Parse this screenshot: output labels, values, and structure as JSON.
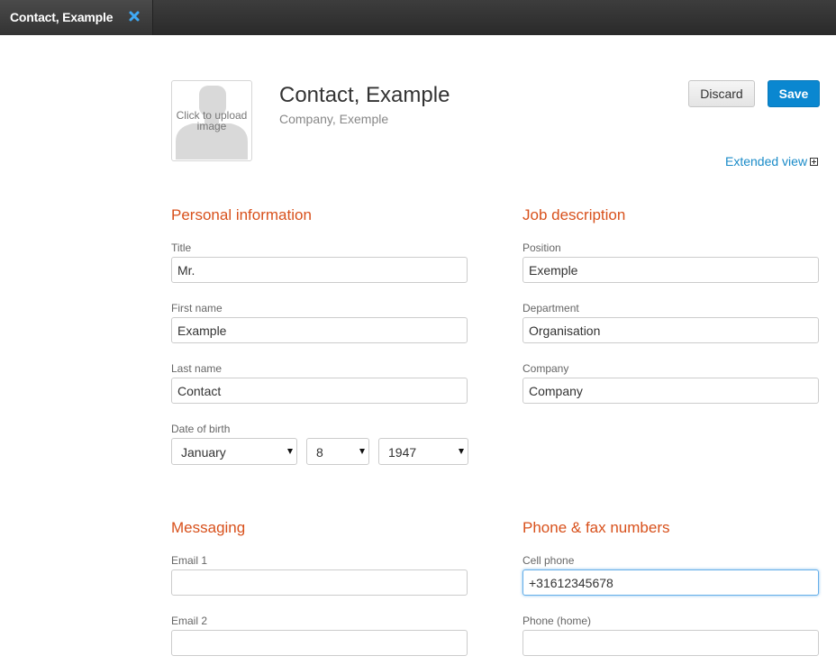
{
  "tab": {
    "label": "Contact, Example",
    "close_icon": "close-icon",
    "close_color": "#3fa9f5"
  },
  "header": {
    "photo_text": "Click to upload image",
    "name": "Contact, Example",
    "company": "Company, Exemple",
    "discard_label": "Discard",
    "save_label": "Save",
    "extended_view_label": "Extended view"
  },
  "personal": {
    "title": "Personal information",
    "title_label": "Title",
    "title_value": "Mr.",
    "first_name_label": "First name",
    "first_name_value": "Example",
    "last_name_label": "Last name",
    "last_name_value": "Contact",
    "dob_label": "Date of birth",
    "dob_month": "January",
    "dob_day": "8",
    "dob_year": "1947"
  },
  "job": {
    "title": "Job description",
    "position_label": "Position",
    "position_value": "Exemple",
    "department_label": "Department",
    "department_value": "Organisation",
    "company_label": "Company",
    "company_value": "Company"
  },
  "messaging": {
    "title": "Messaging",
    "email1_label": "Email 1",
    "email1_value": "",
    "email2_label": "Email 2",
    "email2_value": ""
  },
  "phone": {
    "title": "Phone & fax numbers",
    "cell_label": "Cell phone",
    "cell_value": "+31612345678",
    "home_label": "Phone (home)",
    "home_value": ""
  },
  "colors": {
    "accent": "#d8511c",
    "link": "#1a8bc8",
    "primary_button": "#0a87d0"
  }
}
